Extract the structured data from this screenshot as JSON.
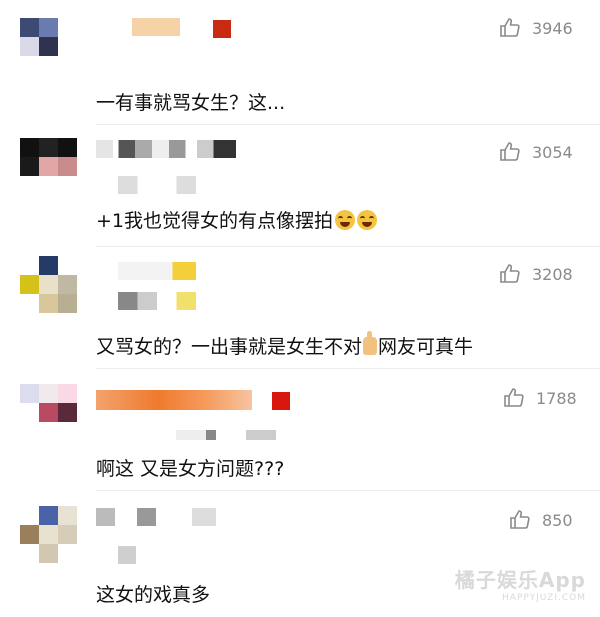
{
  "comments": [
    {
      "likes": "3946",
      "text": "一有事就骂女生？这..."
    },
    {
      "likes": "3054",
      "text": "+1我也觉得女的有点像摆拍"
    },
    {
      "likes": "3208",
      "text_before": "又骂女的？一出事就是女生不对",
      "text_after": "网友可真牛"
    },
    {
      "likes": "1788",
      "text": "啊这 又是女方问题???"
    },
    {
      "likes": "850",
      "text": "这女的戏真多"
    }
  ],
  "watermark": {
    "main": "橘子娱乐App",
    "sub": "HAPPYJUZI.COM"
  },
  "icons": {
    "like": "thumbs-up-icon",
    "laugh_emoji": "laughing-tears-emoji",
    "thumb_emoji": "thumbs-up-emoji"
  },
  "colors": {
    "text": "#111111",
    "like_count": "#8a8a8a",
    "divider": "#ededed",
    "watermark": "#d9d9d9"
  }
}
